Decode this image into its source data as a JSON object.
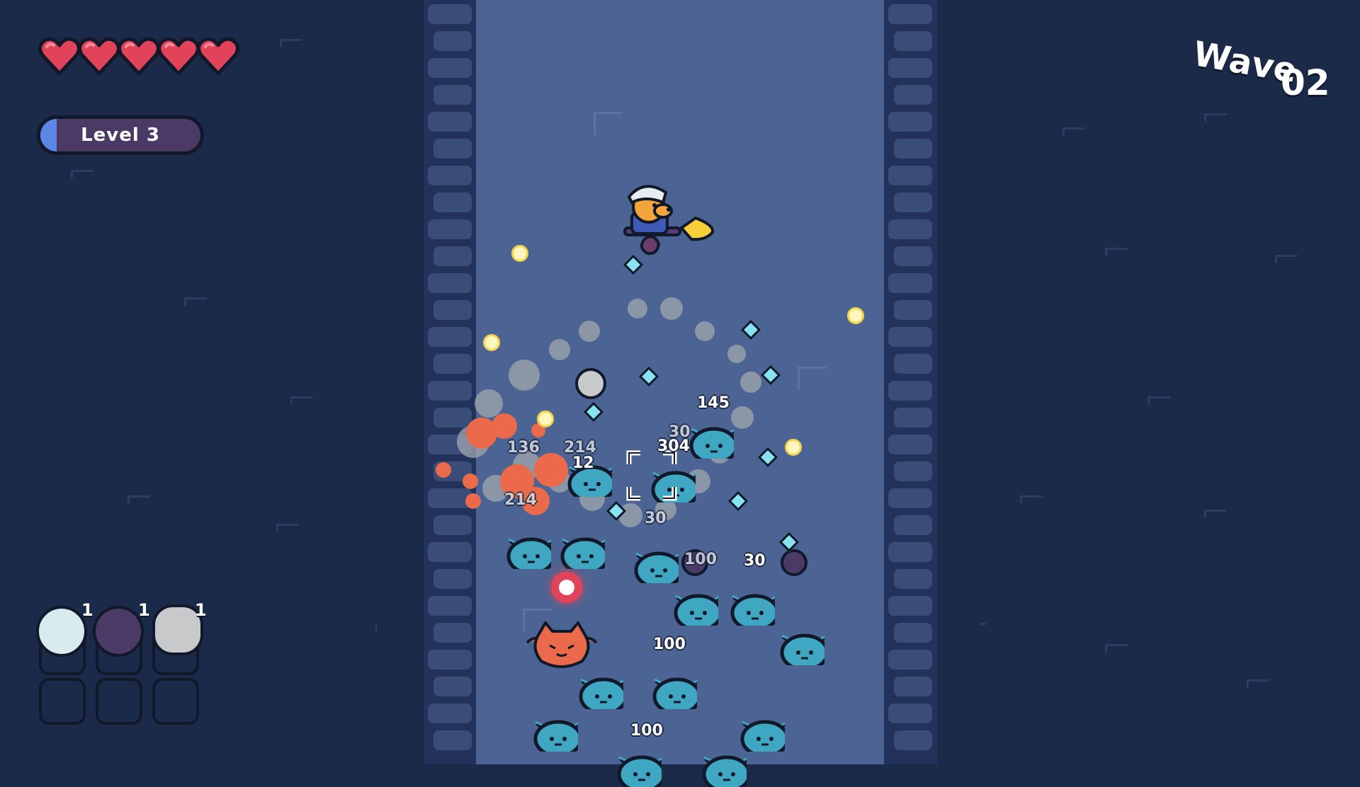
{
  "hud": {
    "hearts": {
      "full": 5,
      "max": 5
    },
    "level": {
      "label": "Level 3",
      "progress": 0.1
    },
    "wave": {
      "word": "Wave",
      "number": "02"
    }
  },
  "inventory": {
    "items": [
      {
        "name": "ghost-orb",
        "count": "1",
        "color": "#d8ecef"
      },
      {
        "name": "spiked-orb",
        "count": "1",
        "color": "#4b3a66"
      },
      {
        "name": "rock-orb",
        "count": "1",
        "color": "#c7c9cb"
      }
    ],
    "empty_slots": 3
  },
  "damage_numbers": [
    "145",
    "30",
    "304",
    "136",
    "214",
    "12",
    "214",
    "30",
    "100",
    "30",
    "100",
    "100"
  ],
  "colors": {
    "background": "#1c2a4a",
    "arena": "#4c6494",
    "slime": "#3fa7c2",
    "heart": "#e0435a",
    "fire": "#ea6a4b"
  }
}
